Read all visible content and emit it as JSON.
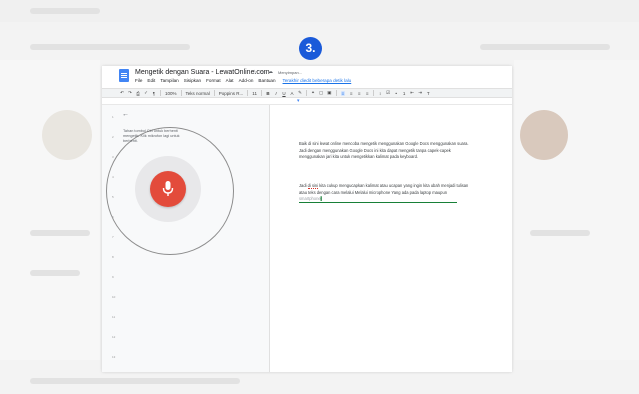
{
  "step": {
    "number": "3."
  },
  "window": {
    "doc_title": "Mengetik dengan Suara - LewatOnline.com",
    "status": "Menyimpan...",
    "menu": [
      "File",
      "Edit",
      "Tampilan",
      "Sisipkan",
      "Format",
      "Alat",
      "Add-on",
      "Bantuan"
    ],
    "last_edit": "Terakhir diedit beberapa detik lalu",
    "toolbar": {
      "zoom": "100%",
      "style": "Teks normal",
      "font": "Poppins R...",
      "size": "11",
      "bold": "B",
      "italic": "I",
      "underline": "U",
      "text_color": "A"
    }
  },
  "voice_panel": {
    "hint": "Tahan tombol Ctrl untuk berhenti mengetik. Klik mikrofon lagi untuk berhenti.",
    "back_icon": "arrow-left-icon",
    "mic_icon": "microphone-icon",
    "mic_color": "#e34b3b"
  },
  "document": {
    "para1": "Baik di sini lewat online mencoba mengetik menggunakan Google Docs menggunakan suara. Jadi dengan menggunakan Google Docs ini kita dapat mengetik tanpa capek-capek menggunakan jari kita untuk mengetikkan kalimat pada keyboard.",
    "para2_prefix": "Jadi ",
    "para2_squiggle": "di sini",
    "para2_main": " kita cukup mengucapkan kalimat atau ucapan yang ingin kita ubah menjadi tulisan atau teks dengan cara melalui Melalui microphone Yang ada pada laptop maupun ",
    "para2_interim": "smartphone",
    "accent": "#188038"
  }
}
